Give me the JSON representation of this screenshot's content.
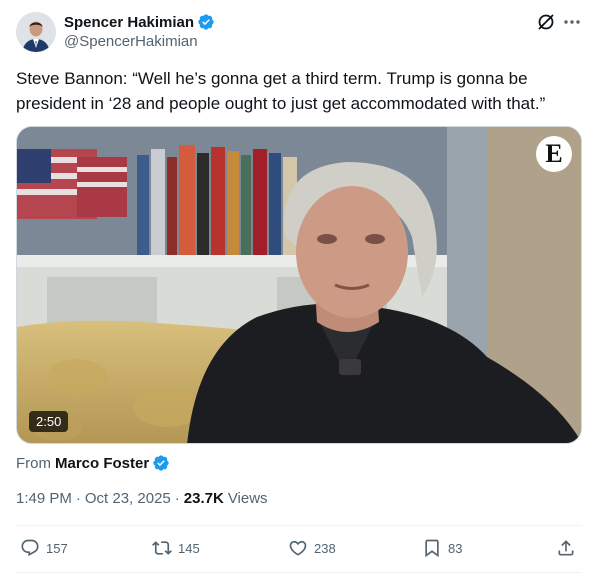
{
  "author": {
    "display_name": "Spencer Hakimian",
    "handle": "@SpencerHakimian",
    "verified": true,
    "verified_color": "#1d9bf0"
  },
  "tweet": {
    "text": "Steve Bannon: “Well he’s gonna get a third term. Trump is gonna be president in ‘28 and people ought to just get accommodated with that.”"
  },
  "media": {
    "duration": "2:50",
    "logo_letter": "E"
  },
  "source": {
    "from_label": "From",
    "from_name": "Marco Foster"
  },
  "meta": {
    "time": "1:49 PM",
    "date": "Oct 23, 2025",
    "views_count": "23.7K",
    "views_label": "Views"
  },
  "actions": {
    "replies": "157",
    "reposts": "145",
    "likes": "238",
    "bookmarks": "83"
  },
  "icons": [
    "verified-badge-icon",
    "grok-icon",
    "more-icon",
    "reply-icon",
    "repost-icon",
    "like-icon",
    "bookmark-icon",
    "share-icon"
  ]
}
